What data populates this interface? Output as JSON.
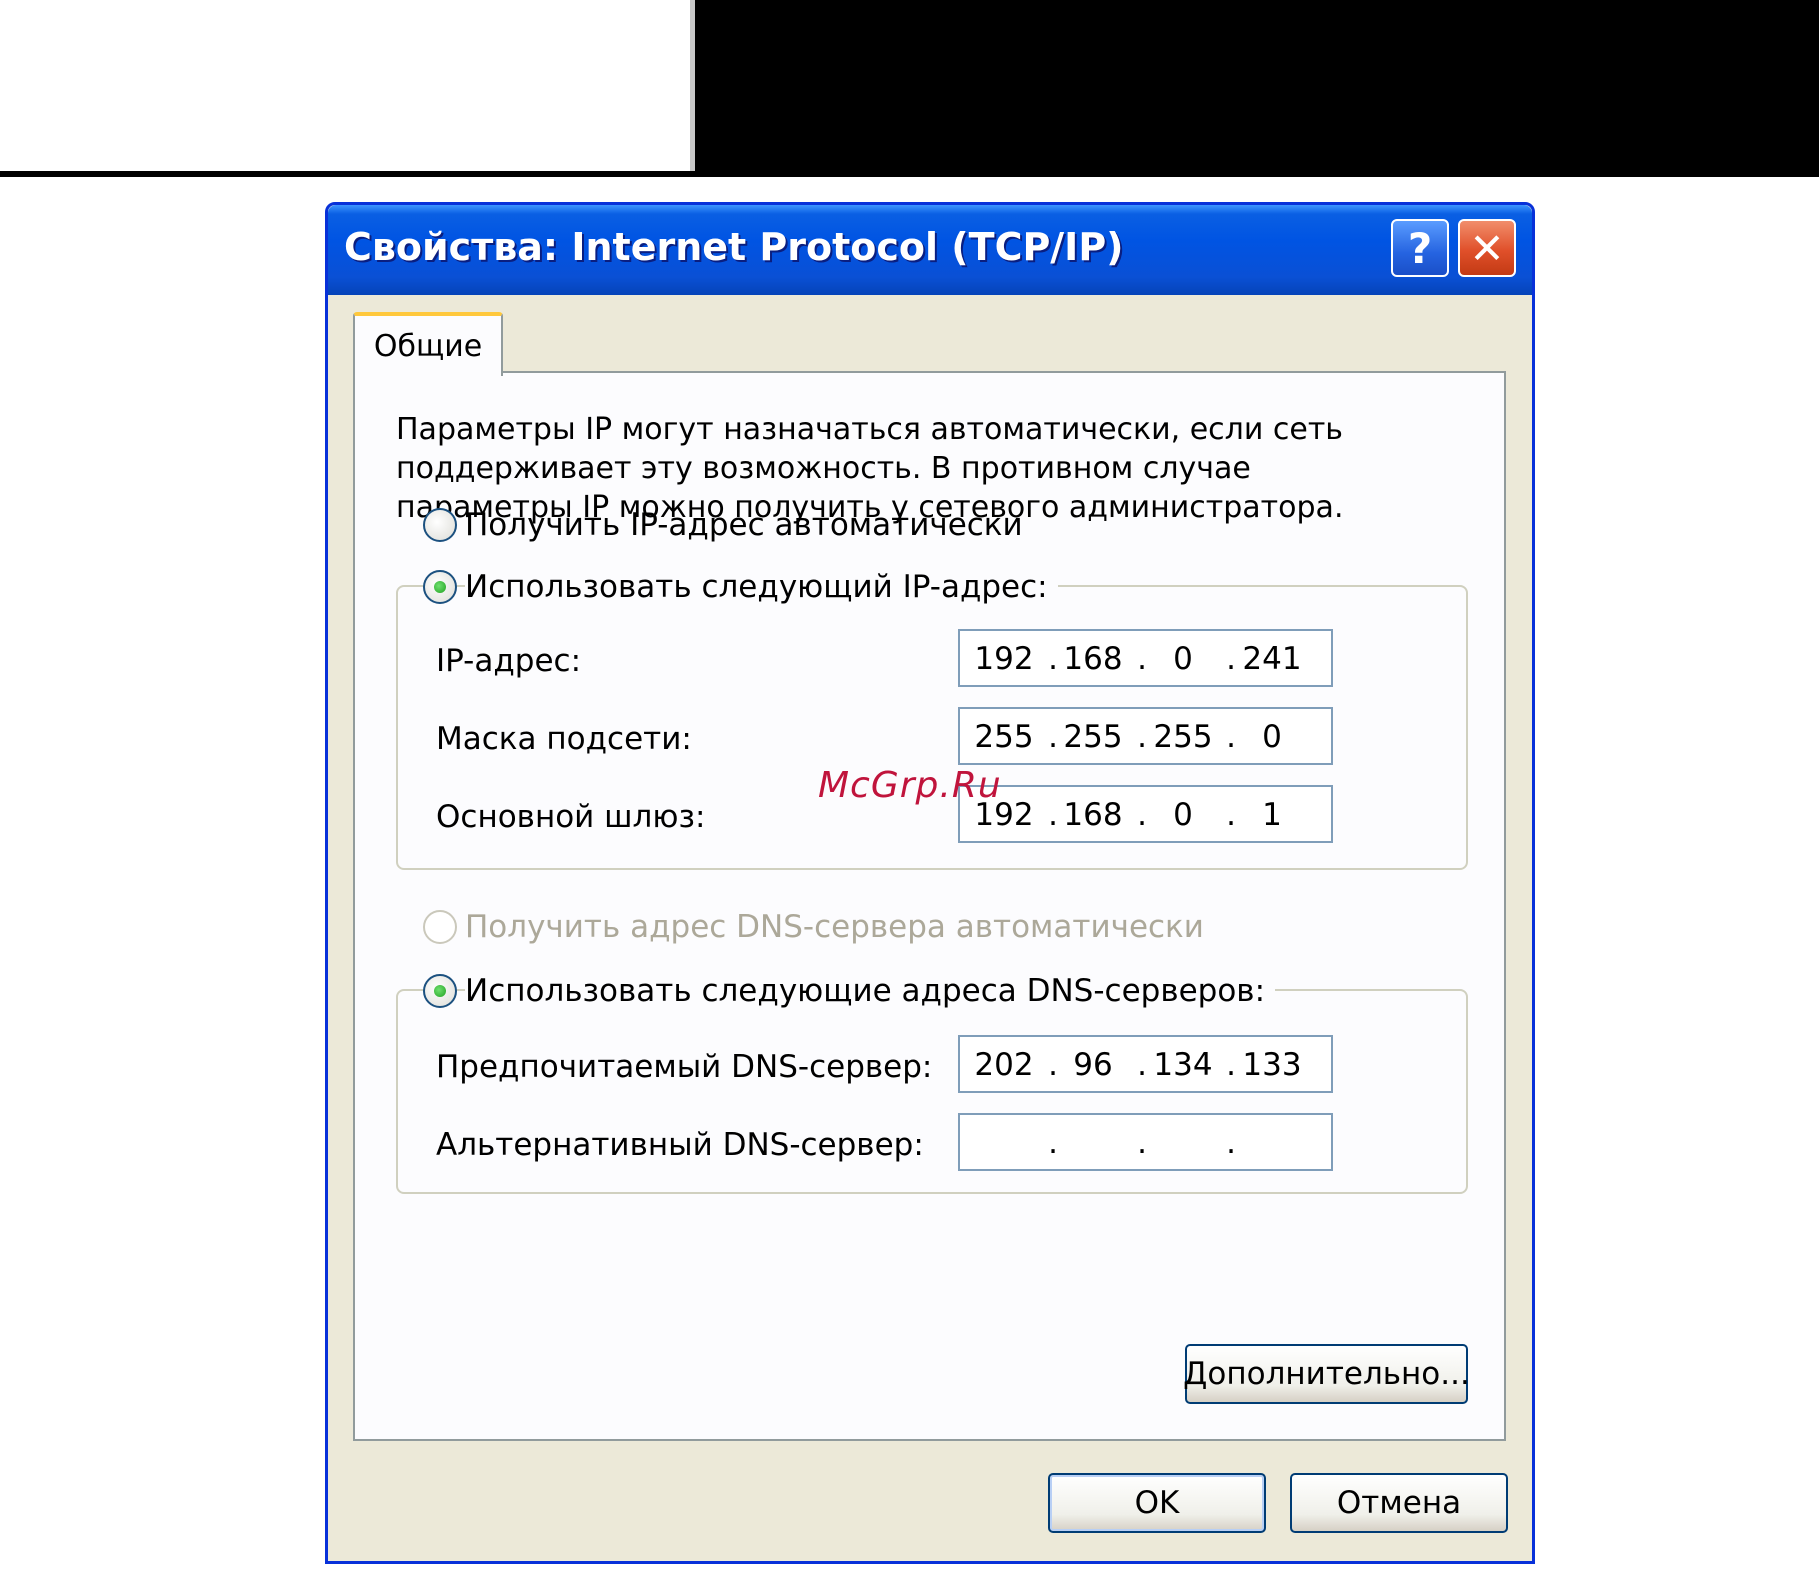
{
  "dialog": {
    "title": "Свойства: Internet Protocol (TCP/IP)",
    "help_label": "?",
    "close_label": "✕"
  },
  "tab": {
    "label": "Общие"
  },
  "description": "Параметры IP могут назначаться автоматически, если сеть поддерживает эту возможность. В противном случае параметры IP можно получить у сетевого администратора.",
  "ip_mode": {
    "auto_label": "Получить IP-адрес автоматически",
    "auto_selected": false,
    "manual_label": "Использовать следующий IP-адрес:",
    "manual_selected": true
  },
  "ip_fields": [
    {
      "label": "IP-адрес:",
      "octets": [
        "192",
        "168",
        "0",
        "241"
      ]
    },
    {
      "label": "Маска подсети:",
      "octets": [
        "255",
        "255",
        "255",
        "0"
      ]
    },
    {
      "label": "Основной шлюз:",
      "octets": [
        "192",
        "168",
        "0",
        "1"
      ]
    }
  ],
  "dns_mode": {
    "auto_label": "Получить адрес DNS-сервера автоматически",
    "auto_selected": false,
    "auto_disabled": true,
    "manual_label": "Использовать следующие адреса DNS-серверов:",
    "manual_selected": true
  },
  "dns_fields": [
    {
      "label": "Предпочитаемый DNS-сервер:",
      "octets": [
        "202",
        "96",
        "134",
        "133"
      ]
    },
    {
      "label": "Альтернативный DNS-сервер:",
      "octets": [
        "",
        "",
        "",
        ""
      ]
    }
  ],
  "buttons": {
    "advanced": "Дополнительно...",
    "ok": "OK",
    "cancel": "Отмена"
  },
  "watermark": "McGrp.Ru"
}
